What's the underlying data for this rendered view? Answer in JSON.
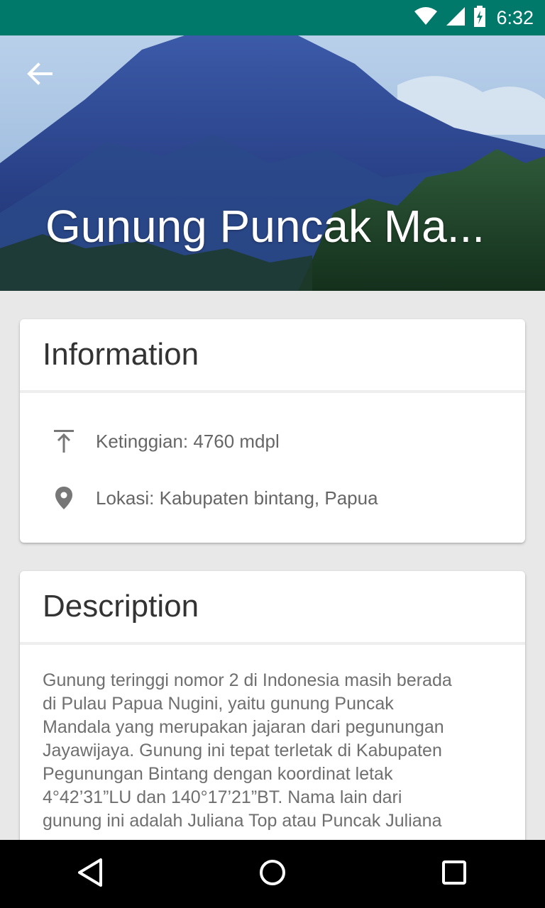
{
  "status_bar": {
    "time": "6:32",
    "icons": [
      "wifi-icon",
      "cell-signal-icon",
      "battery-charging-icon"
    ],
    "background": "#00796b"
  },
  "hero": {
    "title": "Gunung Puncak Ma...",
    "back_icon": "arrow-back-icon"
  },
  "information": {
    "header": "Information",
    "items": [
      {
        "icon": "elevation-icon",
        "text": "Ketinggian: 4760 mdpl"
      },
      {
        "icon": "location-pin-icon",
        "text": "Lokasi: Kabupaten bintang, Papua"
      }
    ]
  },
  "description": {
    "header": "Description",
    "lines": [
      "Gunung teringgi nomor 2 di Indonesia masih berada",
      "di Pulau Papua Nugini, yaitu gunung Puncak",
      "Mandala yang merupakan jajaran dari pegunungan",
      "Jayawijaya. Gunung ini tepat terletak di Kabupaten",
      "Pegunungan Bintang dengan koordinat  letak",
      "4°42’31”LU dan 140°17’21”BT. Nama lain dari",
      "gunung ini adalah Juliana Top atau Puncak Juliana"
    ]
  },
  "nav_bar": {
    "buttons": [
      "back-triangle-icon",
      "home-circle-icon",
      "recents-square-icon"
    ]
  }
}
